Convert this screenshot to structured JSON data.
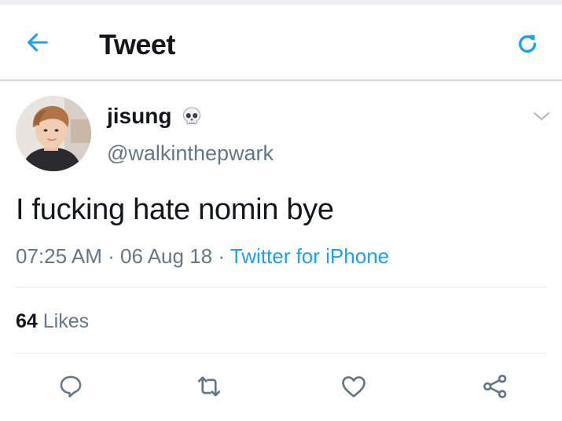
{
  "header": {
    "title": "Tweet",
    "back_icon": "arrow-left-icon",
    "refresh_icon": "refresh-icon"
  },
  "tweet": {
    "display_name": "jisung",
    "name_emoji": "skull-icon",
    "handle": "@walkinthepwark",
    "text": "I fucking hate nomin bye",
    "time": "07:25 AM",
    "separator": "·",
    "date": "06 Aug 18",
    "source": "Twitter for iPhone",
    "likes_count": "64",
    "likes_label": "Likes"
  },
  "actions": [
    "reply-icon",
    "retweet-icon",
    "like-icon",
    "share-icon"
  ],
  "colors": {
    "accent": "#1da1f2",
    "text": "#14171a",
    "muted": "#657786",
    "icon": "#657786",
    "divider": "#e1e8ed"
  }
}
